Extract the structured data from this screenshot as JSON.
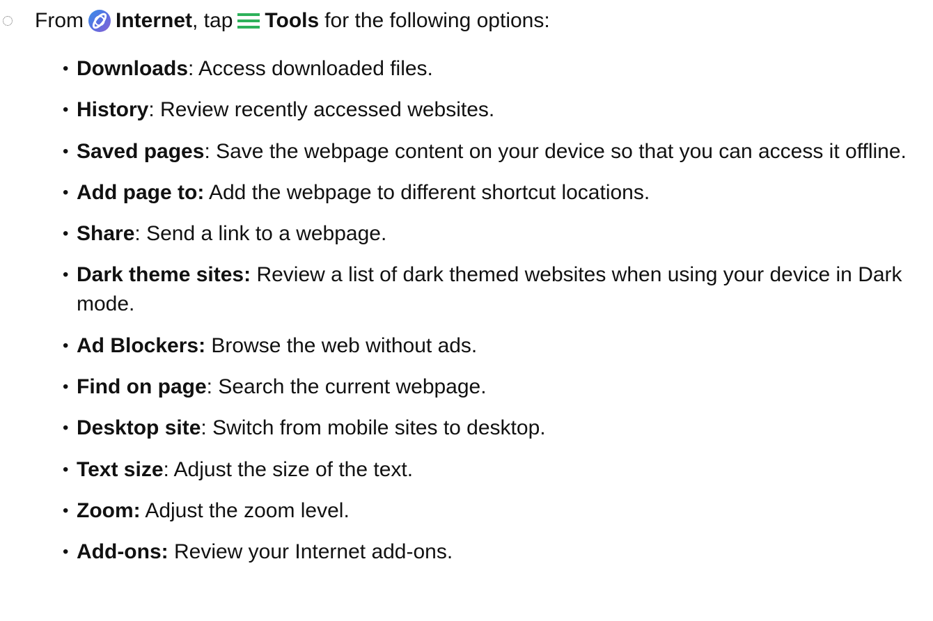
{
  "intro": {
    "prefix": "From",
    "app_name": "Internet",
    "middle": ", tap",
    "menu_name": "Tools",
    "suffix": "for the following options:",
    "app_icon": "samsung-internet-icon",
    "menu_icon": "hamburger-menu-icon",
    "app_icon_colors": [
      "#5b6ee1",
      "#3a8fe8",
      "#8a63d2"
    ],
    "menu_icon_color": "#2db15a"
  },
  "options": [
    {
      "name": "Downloads",
      "sep": ":",
      "desc": " Access downloaded files."
    },
    {
      "name": "History",
      "sep": ":",
      "desc": " Review recently accessed websites."
    },
    {
      "name": "Saved pages",
      "sep": ":",
      "desc": " Save the webpage content on your device so that you can access it offline."
    },
    {
      "name": "Add page to:",
      "sep": "",
      "desc": " Add the webpage to different shortcut locations."
    },
    {
      "name": "Share",
      "sep": ":",
      "desc": " Send a link to a webpage."
    },
    {
      "name": "Dark theme sites:",
      "sep": "",
      "desc": " Review a list of dark themed websites when using your device in Dark mode."
    },
    {
      "name": "Ad Blockers:",
      "sep": "",
      "desc": " Browse the web without ads."
    },
    {
      "name": "Find on page",
      "sep": ":",
      "desc": " Search the current webpage."
    },
    {
      "name": "Desktop site",
      "sep": ":",
      "desc": " Switch from mobile sites to desktop."
    },
    {
      "name": "Text size",
      "sep": ":",
      "desc": " Adjust the size of the text."
    },
    {
      "name": "Zoom:",
      "sep": "",
      "desc": " Adjust the zoom level."
    },
    {
      "name": "Add-ons:",
      "sep": "",
      "desc": " Review your Internet add-ons."
    }
  ]
}
